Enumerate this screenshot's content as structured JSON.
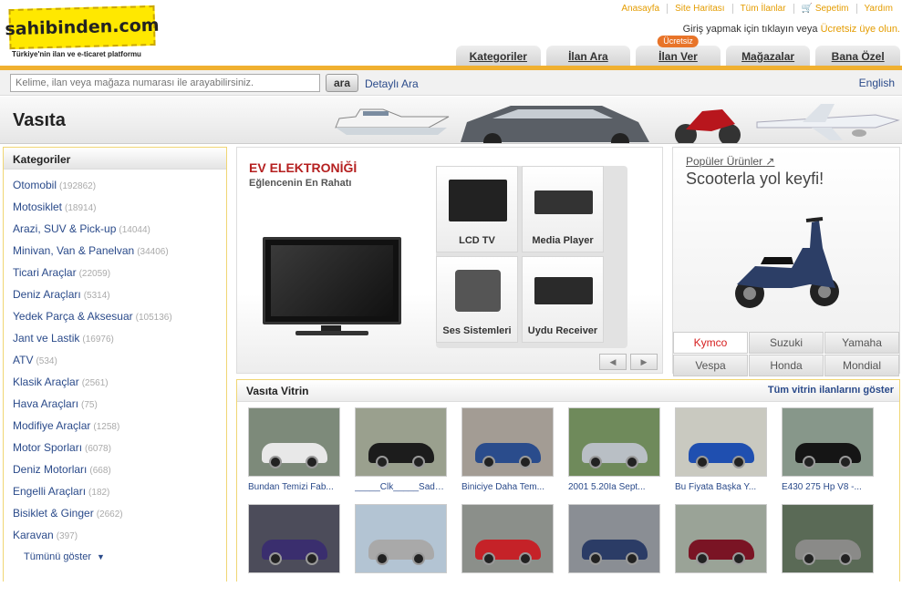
{
  "top_links": [
    "Anasayfa",
    "Site Haritası",
    "Tüm İlanlar",
    "Sepetim",
    "Yardım"
  ],
  "logo_text": "sahibinden.com",
  "slogan": "Türkiye'nin ilan ve e-ticaret platformu",
  "login": {
    "text": "Giriş yapmak için tıklayın veya",
    "link": "Ücretsiz üye olun."
  },
  "tabs": [
    {
      "label": "Kategoriler"
    },
    {
      "label": "İlan Ara"
    },
    {
      "label": "İlan Ver",
      "badge": "Ücretsiz"
    },
    {
      "label": "Mağazalar"
    },
    {
      "label": "Bana Özel"
    }
  ],
  "search": {
    "placeholder": "Kelime, ilan veya mağaza numarası ile arayabilirsiniz.",
    "button": "ara",
    "advanced": "Detaylı Ara",
    "language": "English"
  },
  "banner_title": "Vasıta",
  "categories": {
    "heading": "Kategoriler",
    "items": [
      {
        "label": "Otomobil",
        "count": "(192862)"
      },
      {
        "label": "Motosiklet",
        "count": "(18914)"
      },
      {
        "label": "Arazi, SUV & Pick-up",
        "count": "(14044)"
      },
      {
        "label": "Minivan, Van & Panelvan",
        "count": "(34406)"
      },
      {
        "label": "Ticari Araçlar",
        "count": "(22059)"
      },
      {
        "label": "Deniz Araçları",
        "count": "(5314)"
      },
      {
        "label": "Yedek Parça & Aksesuar",
        "count": "(105136)"
      },
      {
        "label": "Jant ve Lastik",
        "count": "(16976)"
      },
      {
        "label": "ATV",
        "count": "(534)"
      },
      {
        "label": "Klasik Araçlar",
        "count": "(2561)"
      },
      {
        "label": "Hava Araçları",
        "count": "(75)"
      },
      {
        "label": "Modifiye Araçlar",
        "count": "(1258)"
      },
      {
        "label": "Motor Sporları",
        "count": "(6078)"
      },
      {
        "label": "Deniz Motorları",
        "count": "(668)"
      },
      {
        "label": "Engelli Araçları",
        "count": "(182)"
      },
      {
        "label": "Bisiklet & Ginger",
        "count": "(2662)"
      },
      {
        "label": "Karavan",
        "count": "(397)"
      }
    ],
    "show_all": "Tümünü göster"
  },
  "promo": {
    "title": "EV ELEKTRONİĞİ",
    "subtitle": "Eğlencenin En Rahatı",
    "cells": [
      "LCD TV",
      "Media Player",
      "Ses Sistemleri",
      "Uydu Receiver"
    ]
  },
  "popular": {
    "link": "Popüler Ürünler",
    "title": "Scooterla yol keyfi!",
    "brands": [
      "Kymco",
      "Suzuki",
      "Yamaha",
      "Vespa",
      "Honda",
      "Mondial"
    ]
  },
  "vitrin": {
    "heading": "Vasıta Vitrin",
    "all_link": "Tüm vitrin ilanlarını göster",
    "items": [
      {
        "caption": "Bundan Temizi Fab...",
        "color": "#e8e8e8",
        "bg": "#7d8a7a"
      },
      {
        "caption": "_____Clk_____Sade...",
        "color": "#1c1c1c",
        "bg": "#9aa08e"
      },
      {
        "caption": "Biniciye Daha Tem...",
        "color": "#2a4c8c",
        "bg": "#a39c94"
      },
      {
        "caption": "2001 5.20İa Sept...",
        "color": "#b9bfc5",
        "bg": "#6f8a5b"
      },
      {
        "caption": "Bu Fiyata Başka Y...",
        "color": "#1f4fb0",
        "bg": "#c9c9c0"
      },
      {
        "caption": "E430 275 Hp V8 -...",
        "color": "#151515",
        "bg": "#87978a"
      },
      {
        "caption": "",
        "color": "#3a2e6e",
        "bg": "#4c4c5a"
      },
      {
        "caption": "",
        "color": "#a9a9a9",
        "bg": "#b3c4d3"
      },
      {
        "caption": "",
        "color": "#c52228",
        "bg": "#8b8f8a"
      },
      {
        "caption": "",
        "color": "#2b3c66",
        "bg": "#8a8e94"
      },
      {
        "caption": "",
        "color": "#7a1424",
        "bg": "#9aa397"
      },
      {
        "caption": "",
        "color": "#8a8a88",
        "bg": "#5a6a56"
      }
    ]
  }
}
